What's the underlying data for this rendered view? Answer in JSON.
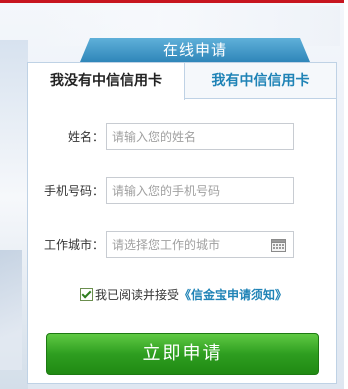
{
  "header": {
    "title": "在线申请"
  },
  "tabs": [
    {
      "label": "我没有中信信用卡",
      "active": true
    },
    {
      "label": "我有中信信用卡",
      "active": false
    }
  ],
  "form": {
    "name": {
      "label": "姓名：",
      "placeholder": "请输入您的姓名"
    },
    "phone": {
      "label": "手机号码：",
      "placeholder": "请输入您的手机号码"
    },
    "city": {
      "label": "工作城市：",
      "placeholder": "请选择您工作的城市"
    }
  },
  "agreement": {
    "checked": true,
    "text": "我已阅读并接受",
    "link": "《信金宝申请须知》"
  },
  "submit_label": "立即申请",
  "colors": {
    "accent_blue": "#1f83b6",
    "button_green": "#2e9e20",
    "top_red": "#c7151f"
  },
  "icons": {
    "city_picker": "calendar-icon"
  }
}
